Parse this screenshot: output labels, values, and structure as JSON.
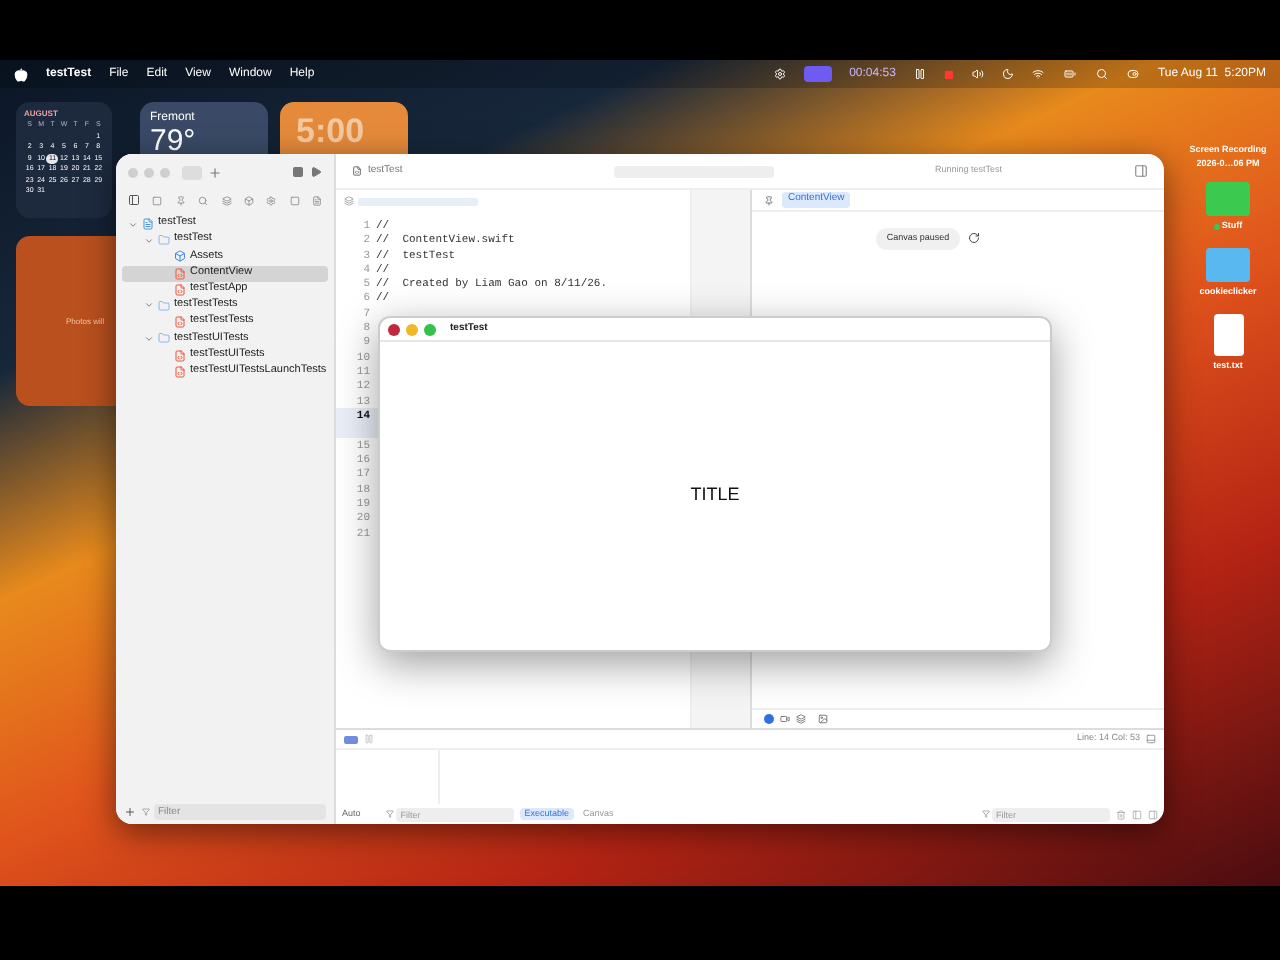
{
  "menu_bar": {
    "app": "testTest",
    "menus": [
      "File",
      "Edit",
      "View",
      "Window",
      "Help"
    ],
    "timer": "00:04:53",
    "clock": "Tue Aug 11  5:20PM"
  },
  "widgets": {
    "calendar": {
      "month": "AUGUST",
      "weekdays": [
        "S",
        "M",
        "T",
        "W",
        "T",
        "F",
        "S"
      ],
      "days": [
        {
          "label": "1",
          "selected": false
        },
        {
          "label": "2",
          "selected": false
        },
        {
          "label": "3",
          "selected": false
        },
        {
          "label": "4",
          "selected": false
        },
        {
          "label": "5",
          "selected": false
        },
        {
          "label": "6",
          "selected": false
        },
        {
          "label": "7",
          "selected": false
        },
        {
          "label": "8",
          "selected": false
        },
        {
          "label": "9",
          "selected": false
        },
        {
          "label": "10",
          "selected": false
        },
        {
          "label": "11",
          "selected": true
        },
        {
          "label": "12",
          "selected": false
        },
        {
          "label": "13",
          "selected": false
        },
        {
          "label": "14",
          "selected": false
        },
        {
          "label": "15",
          "selected": false
        },
        {
          "label": "16",
          "selected": false
        },
        {
          "label": "17",
          "selected": false
        },
        {
          "label": "18",
          "selected": false
        },
        {
          "label": "19",
          "selected": false
        },
        {
          "label": "20",
          "selected": false
        },
        {
          "label": "21",
          "selected": false
        },
        {
          "label": "22",
          "selected": false
        },
        {
          "label": "23",
          "selected": false
        },
        {
          "label": "24",
          "selected": false
        },
        {
          "label": "25",
          "selected": false
        },
        {
          "label": "26",
          "selected": false
        },
        {
          "label": "27",
          "selected": false
        },
        {
          "label": "28",
          "selected": false
        },
        {
          "label": "29",
          "selected": false
        },
        {
          "label": "30",
          "selected": false
        },
        {
          "label": "31",
          "selected": false
        }
      ]
    },
    "weather": {
      "city": "Fremont",
      "temperature": "79°"
    },
    "clock": {
      "time": "5:00"
    },
    "photos": {
      "text": "Photos will"
    }
  },
  "desktop_icons": [
    {
      "kind": "recording",
      "title": "Screen Recording",
      "subtitle": "2026-0…06 PM"
    },
    {
      "kind": "folder",
      "title": "Stuff",
      "color": "#34c759"
    },
    {
      "kind": "folder",
      "title": "cookieclicker"
    },
    {
      "kind": "file",
      "title": "test.txt"
    }
  ],
  "xcode": {
    "toolbar": {
      "tab": "testTest",
      "status": "Running testTest"
    },
    "navigator": {
      "tree": [
        {
          "label": "testTest",
          "kind": "project",
          "selected": false,
          "expanded": true,
          "children": [
            {
              "label": "testTest",
              "kind": "folder",
              "selected": false,
              "expanded": true,
              "children": [
                {
                  "label": "Assets",
                  "kind": "assets",
                  "selected": false
                },
                {
                  "label": "ContentView",
                  "kind": "swift",
                  "selected": true
                },
                {
                  "label": "testTestApp",
                  "kind": "swift",
                  "selected": false
                }
              ]
            },
            {
              "label": "testTestTests",
              "kind": "folder",
              "selected": false,
              "expanded": true,
              "children": [
                {
                  "label": "testTestTests",
                  "kind": "swift",
                  "selected": false
                }
              ]
            },
            {
              "label": "testTestUITests",
              "kind": "folder",
              "selected": false,
              "expanded": true,
              "children": [
                {
                  "label": "testTestUITests",
                  "kind": "swift",
                  "selected": false
                },
                {
                  "label": "testTestUITestsLaunchTests",
                  "kind": "swift",
                  "selected": false
                }
              ]
            }
          ]
        }
      ],
      "filter_placeholder": "Filter"
    },
    "editor": {
      "lines": [
        {
          "number": "1",
          "text": "//",
          "current": false
        },
        {
          "number": "2",
          "text": "//  ContentView.swift",
          "current": false
        },
        {
          "number": "3",
          "text": "//  testTest",
          "current": false
        },
        {
          "number": "4",
          "text": "//",
          "current": false
        },
        {
          "number": "5",
          "text": "//  Created by Liam Gao on 8/11/26.",
          "current": false
        },
        {
          "number": "6",
          "text": "//",
          "current": false
        },
        {
          "number": "7",
          "current": false
        },
        {
          "number": "8",
          "current": false
        },
        {
          "number": "9",
          "current": false
        },
        {
          "number": "10",
          "current": false
        },
        {
          "number": "11",
          "current": false
        },
        {
          "number": "12",
          "current": false
        },
        {
          "number": "13",
          "current": false
        },
        {
          "number": "14",
          "current": true
        },
        {
          "number": "15",
          "current": false
        },
        {
          "number": "16",
          "current": false
        },
        {
          "number": "17",
          "current": false
        },
        {
          "number": "18",
          "current": false
        },
        {
          "number": "19",
          "current": false
        },
        {
          "number": "20",
          "current": false
        },
        {
          "number": "21",
          "current": false
        }
      ]
    },
    "canvas": {
      "chip": "ContentView",
      "message": "Canvas paused"
    },
    "debug": {
      "cursor": "Line: 14 Col: 53",
      "scope": "Auto",
      "filter_left_placeholder": "Filter",
      "tabs": [
        {
          "label": "Executable",
          "selected": true
        },
        {
          "label": "Canvas",
          "selected": false
        }
      ],
      "filter_right_placeholder": "Filter"
    }
  },
  "app_window": {
    "title": "testTest",
    "content": "TITLE"
  }
}
